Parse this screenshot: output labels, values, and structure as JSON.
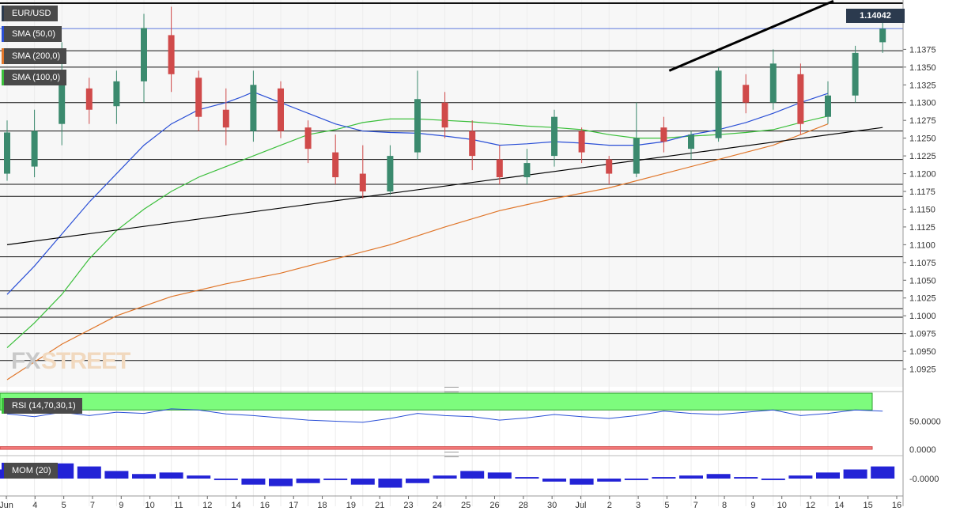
{
  "chart_data": [
    {
      "type": "candlestick",
      "symbol": "EUR/USD",
      "legend": [
        {
          "label": "EUR/USD",
          "color": "#2b3a4e"
        },
        {
          "label": "SMA (50,0)",
          "color": "#2a4fd6"
        },
        {
          "label": "SMA (200,0)",
          "color": "#e0762a"
        },
        {
          "label": "SMA (100,0)",
          "color": "#3bbf3b"
        }
      ],
      "last_price": "1.14042",
      "ylim": [
        1.09,
        1.144
      ],
      "y_ticks": [
        "1.1375",
        "1.1350",
        "1.1325",
        "1.1300",
        "1.1275",
        "1.1250",
        "1.1225",
        "1.1200",
        "1.1175",
        "1.1150",
        "1.1125",
        "1.1100",
        "1.1075",
        "1.1050",
        "1.1025",
        "1.1000",
        "1.0975",
        "1.0950",
        "1.0925"
      ],
      "x_ticks": [
        "Jun",
        "4",
        "5",
        "7",
        "9",
        "10",
        "11",
        "12",
        "14",
        "16",
        "17",
        "18",
        "19",
        "21",
        "23",
        "24",
        "25",
        "26",
        "28",
        "30",
        "Jul",
        "2",
        "3",
        "5",
        "7",
        "8",
        "9",
        "10",
        "12",
        "14",
        "15",
        "16"
      ],
      "horizontal_levels": [
        1.144,
        1.1373,
        1.135,
        1.13,
        1.126,
        1.122,
        1.1185,
        1.1168,
        1.1083,
        1.1035,
        1.101,
        1.0998,
        1.0975,
        1.0937
      ],
      "trendlines": [
        {
          "x_days": [
            0,
            32
          ],
          "y": [
            1.11,
            1.1265
          ],
          "weight": "thin"
        },
        {
          "x_days": [
            24.2,
            30.2
          ],
          "y": [
            1.1345,
            1.1443
          ],
          "weight": "thick"
        }
      ],
      "sma50": [
        [
          0,
          1.103
        ],
        [
          1,
          1.107
        ],
        [
          2,
          1.1115
        ],
        [
          3,
          1.116
        ],
        [
          4,
          1.12
        ],
        [
          5,
          1.124
        ],
        [
          6,
          1.127
        ],
        [
          7,
          1.129
        ],
        [
          8,
          1.13
        ],
        [
          8.5,
          1.1307
        ],
        [
          9,
          1.1315
        ],
        [
          10,
          1.13
        ],
        [
          11,
          1.1285
        ],
        [
          12,
          1.127
        ],
        [
          13,
          1.126
        ],
        [
          14,
          1.1258
        ],
        [
          15,
          1.1257
        ],
        [
          16,
          1.1253
        ],
        [
          17,
          1.1248
        ],
        [
          18,
          1.124
        ],
        [
          19,
          1.1242
        ],
        [
          20,
          1.1245
        ],
        [
          21,
          1.1243
        ],
        [
          22,
          1.124
        ],
        [
          23,
          1.124
        ],
        [
          24,
          1.1245
        ],
        [
          25,
          1.1255
        ],
        [
          26,
          1.1262
        ],
        [
          27,
          1.1272
        ],
        [
          28,
          1.1285
        ],
        [
          29,
          1.13
        ],
        [
          30,
          1.1313
        ]
      ],
      "sma100": [
        [
          0,
          1.0955
        ],
        [
          1,
          1.099
        ],
        [
          2,
          1.103
        ],
        [
          3,
          1.108
        ],
        [
          4,
          1.112
        ],
        [
          5,
          1.115
        ],
        [
          6,
          1.1175
        ],
        [
          7,
          1.1195
        ],
        [
          8,
          1.121
        ],
        [
          9,
          1.1225
        ],
        [
          10,
          1.124
        ],
        [
          11,
          1.1255
        ],
        [
          12,
          1.1262
        ],
        [
          13,
          1.1272
        ],
        [
          14,
          1.1277
        ],
        [
          15,
          1.1277
        ],
        [
          16,
          1.1275
        ],
        [
          17,
          1.1273
        ],
        [
          18,
          1.127
        ],
        [
          19,
          1.1267
        ],
        [
          20,
          1.1265
        ],
        [
          21,
          1.1262
        ],
        [
          22,
          1.1255
        ],
        [
          23,
          1.125
        ],
        [
          24,
          1.125
        ],
        [
          25,
          1.1253
        ],
        [
          26,
          1.1255
        ],
        [
          27,
          1.1258
        ],
        [
          28,
          1.1262
        ],
        [
          29,
          1.1272
        ],
        [
          30,
          1.1281
        ]
      ],
      "sma200": [
        [
          0,
          1.091
        ],
        [
          2,
          1.096
        ],
        [
          4,
          1.1
        ],
        [
          6,
          1.1027
        ],
        [
          8,
          1.1045
        ],
        [
          10,
          1.106
        ],
        [
          12,
          1.108
        ],
        [
          14,
          1.11
        ],
        [
          16,
          1.1125
        ],
        [
          18,
          1.1148
        ],
        [
          20,
          1.1165
        ],
        [
          22,
          1.118
        ],
        [
          24,
          1.12
        ],
        [
          26,
          1.122
        ],
        [
          28,
          1.124
        ],
        [
          30,
          1.127
        ]
      ],
      "candles_by_day": [
        [
          0,
          1.12,
          1.1258,
          1.119,
          1.1275
        ],
        [
          1,
          1.121,
          1.126,
          1.1195,
          1.129
        ],
        [
          2,
          1.127,
          1.1335,
          1.124,
          1.1385
        ],
        [
          3,
          1.132,
          1.129,
          1.127,
          1.1335
        ],
        [
          4,
          1.1295,
          1.133,
          1.127,
          1.1345
        ],
        [
          5,
          1.133,
          1.1405,
          1.13,
          1.1425
        ],
        [
          6,
          1.1395,
          1.134,
          1.1315,
          1.1435
        ],
        [
          7,
          1.1335,
          1.128,
          1.126,
          1.1345
        ],
        [
          8,
          1.129,
          1.1265,
          1.124,
          1.132
        ],
        [
          9,
          1.126,
          1.1325,
          1.1245,
          1.1345
        ],
        [
          10,
          1.132,
          1.126,
          1.125,
          1.133
        ],
        [
          11,
          1.1265,
          1.1235,
          1.1215,
          1.1275
        ],
        [
          12,
          1.123,
          1.1195,
          1.1185,
          1.1255
        ],
        [
          13,
          1.12,
          1.1175,
          1.1165,
          1.124
        ],
        [
          14,
          1.1175,
          1.1225,
          1.117,
          1.124
        ],
        [
          15,
          1.123,
          1.1305,
          1.122,
          1.1345
        ],
        [
          16,
          1.13,
          1.1265,
          1.125,
          1.1315
        ],
        [
          17,
          1.126,
          1.1225,
          1.1205,
          1.1275
        ],
        [
          18,
          1.122,
          1.1195,
          1.1185,
          1.124
        ],
        [
          19,
          1.1195,
          1.1215,
          1.1185,
          1.1235
        ],
        [
          20,
          1.1225,
          1.128,
          1.121,
          1.129
        ],
        [
          21,
          1.126,
          1.123,
          1.1215,
          1.1265
        ],
        [
          22,
          1.122,
          1.12,
          1.1185,
          1.1225
        ],
        [
          23,
          1.12,
          1.125,
          1.1195,
          1.13
        ],
        [
          24,
          1.1265,
          1.1245,
          1.123,
          1.128
        ],
        [
          25,
          1.1235,
          1.1255,
          1.122,
          1.126
        ],
        [
          26,
          1.125,
          1.1345,
          1.1245,
          1.135
        ],
        [
          27,
          1.1325,
          1.13,
          1.1285,
          1.134
        ],
        [
          28,
          1.13,
          1.1355,
          1.129,
          1.1375
        ],
        [
          29,
          1.134,
          1.127,
          1.1255,
          1.1355
        ],
        [
          30,
          1.128,
          1.131,
          1.127,
          1.133
        ],
        [
          31,
          1.131,
          1.137,
          1.13,
          1.138
        ],
        [
          32,
          1.1385,
          1.1404,
          1.137,
          1.142
        ]
      ]
    },
    {
      "type": "line",
      "name": "RSI (14,70,30,1)",
      "tick_label": "50.0000",
      "tick_label_low": "0.0000",
      "ylim": [
        0,
        100
      ],
      "overbought": 70,
      "oversold": 30,
      "values": [
        63,
        58,
        66,
        60,
        66,
        64,
        72,
        70,
        63,
        60,
        56,
        52,
        50,
        48,
        55,
        64,
        60,
        58,
        52,
        56,
        62,
        58,
        55,
        60,
        68,
        64,
        62,
        66,
        70,
        60,
        64,
        70,
        68
      ]
    },
    {
      "type": "bar",
      "name": "MOM (20)",
      "tick_label": "-0.0000",
      "ylim": [
        -0.012,
        0.012
      ],
      "values": [
        0.006,
        0.008,
        0.01,
        0.008,
        0.005,
        0.003,
        0.004,
        0.002,
        -0.001,
        -0.004,
        -0.005,
        -0.003,
        -0.001,
        -0.004,
        -0.006,
        -0.003,
        0.002,
        0.005,
        0.004,
        0.001,
        -0.002,
        -0.004,
        -0.002,
        -0.001,
        0.001,
        0.002,
        0.003,
        0.001,
        -0.001,
        0.002,
        0.004,
        0.006,
        0.008
      ]
    }
  ]
}
